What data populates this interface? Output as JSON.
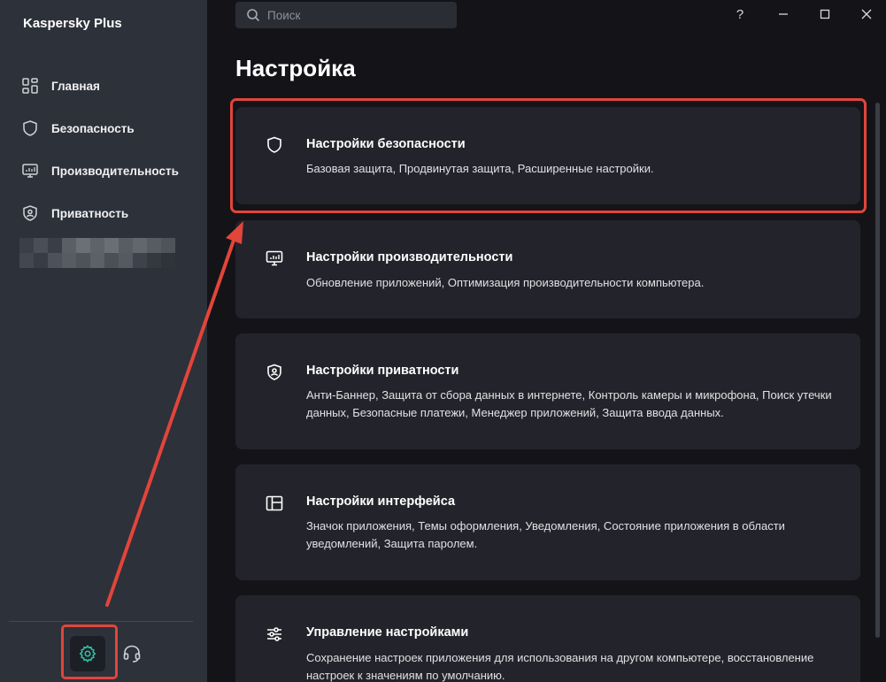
{
  "app": {
    "brand": "Kaspersky Plus"
  },
  "sidebar": {
    "items": [
      {
        "label": "Главная",
        "icon": "home-grid-icon"
      },
      {
        "label": "Безопасность",
        "icon": "shield-icon"
      },
      {
        "label": "Производительность",
        "icon": "monitor-icon"
      },
      {
        "label": "Приватность",
        "icon": "privacy-shield-icon"
      }
    ],
    "footer": {
      "settings_icon": "gear-icon",
      "support_icon": "headset-icon"
    }
  },
  "search": {
    "placeholder": "Поиск"
  },
  "window": {
    "help": "?"
  },
  "page": {
    "title": "Настройка"
  },
  "cards": [
    {
      "title": "Настройки безопасности",
      "desc": "Базовая защита, Продвинутая защита, Расширенные настройки.",
      "icon": "shield-icon"
    },
    {
      "title": "Настройки производительности",
      "desc": "Обновление приложений, Оптимизация производительности компьютера.",
      "icon": "monitor-icon"
    },
    {
      "title": "Настройки приватности",
      "desc": "Анти-Баннер, Защита от сбора данных в интернете, Контроль камеры и микрофона, Поиск утечки данных, Безопасные платежи, Менеджер приложений, Защита ввода данных.",
      "icon": "privacy-shield-icon"
    },
    {
      "title": "Настройки интерфейса",
      "desc": "Значок приложения, Темы оформления, Уведомления, Состояние приложения в области уведомлений, Защита паролем.",
      "icon": "layout-icon"
    },
    {
      "title": "Управление настройками",
      "desc": "Сохранение настроек приложения для использования на другом компьютере, восстановление настроек к значениям по умолчанию.",
      "icon": "sliders-icon"
    }
  ],
  "colors": {
    "accent": "#2ec4a4",
    "annotation": "#e2453b",
    "sidebar": "#2d3139",
    "card": "#23232b",
    "background": "#141418"
  }
}
